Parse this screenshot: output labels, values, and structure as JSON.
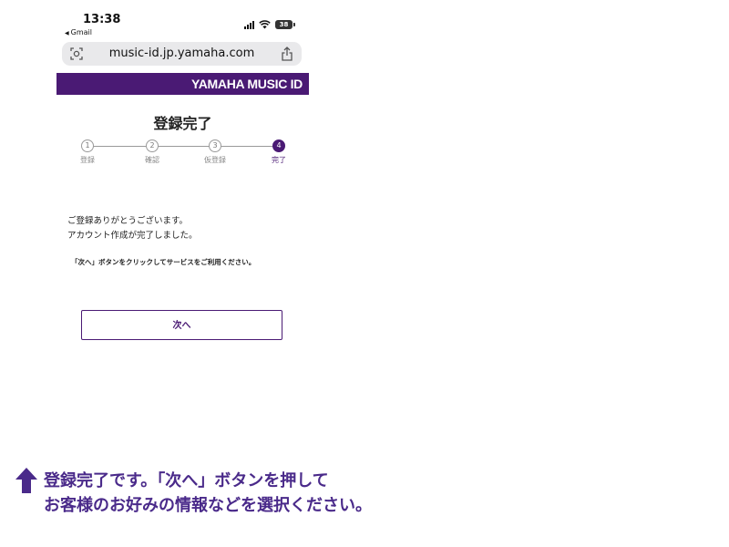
{
  "status_bar": {
    "time": "13:38",
    "back_app": "Gmail",
    "battery": "38"
  },
  "browser": {
    "url": "music-id.jp.yamaha.com"
  },
  "banner": {
    "brand": "YAMAHA MUSIC ID",
    "color": "#4a1a74"
  },
  "page": {
    "title": "登録完了",
    "steps": [
      {
        "num": "1",
        "label": "登録",
        "active": false
      },
      {
        "num": "2",
        "label": "確認",
        "active": false
      },
      {
        "num": "3",
        "label": "仮登録",
        "active": false
      },
      {
        "num": "4",
        "label": "完了",
        "active": true
      }
    ],
    "message_line1": "ご登録ありがとうございます。",
    "message_line2": "アカウント作成が完了しました。",
    "note": "「次へ」ボタンをクリックしてサービスをご利用ください。",
    "next_button": "次へ"
  },
  "caption": {
    "line1": "登録完了です。「次へ」ボタンを押して",
    "line2": "お客様のお好みの情報などを選択ください。",
    "color": "#4a2a8a"
  }
}
